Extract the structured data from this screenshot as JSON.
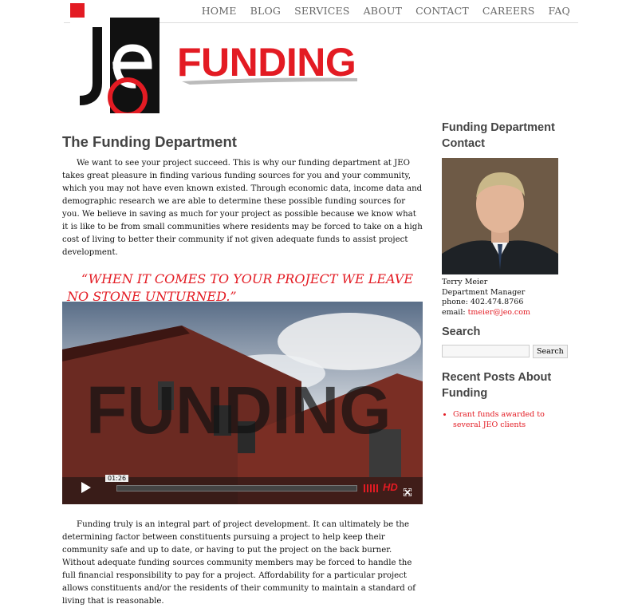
{
  "nav": {
    "items": [
      "HOME",
      "BLOG",
      "SERVICES",
      "ABOUT",
      "CONTACT",
      "CAREERS",
      "FAQ"
    ]
  },
  "logo": {
    "text": "JEO"
  },
  "banner": {
    "title": "FUNDING"
  },
  "main": {
    "heading": "The Funding Department",
    "intro": "We want to see your project succeed. This is why our funding department at JEO takes great pleasure in finding various funding sources for you and your community, which you may not have even known existed. Through economic data, income data and demographic research we are able to determine these possible funding sources for you. We believe in saving as much for your project as possible because we know what it is like to be from small communities where residents may be forced to take on a high cost of living to better their community if not given adequate funds to assist project development.",
    "quote": "“WHEN IT COMES TO YOUR PROJECT WE LEAVE NO STONE UNTURNED.”",
    "video": {
      "overlay_text": "FUNDING",
      "time": "01:26",
      "hd_label": "HD",
      "progress": 0.0
    },
    "body": "Funding truly is an integral part of project development. It can ultimately be the determining factor between constituents pursuing a project to help keep their community safe and up to date, or having to put the project on the back burner. Without adequate funding sources community members may be forced to handle the full financial responsibility to pay for a project. Affordability for a particular project allows constituents and/or the residents of their community to maintain a standard of living that is reasonable."
  },
  "sidebar": {
    "contact_heading": "Funding Department Contact",
    "name": "Terry Meier",
    "title": "Department Manager",
    "phone": "phone: 402.474.8766",
    "email_label": "email: ",
    "email": "tmeier@jeo.com",
    "search_heading": "Search",
    "search_button": "Search",
    "search_placeholder": "",
    "recent_heading": "Recent Posts About Funding",
    "posts": [
      "Grant funds awarded to several JEO clients"
    ]
  },
  "colors": {
    "accent": "#e31b23",
    "heading": "#444444",
    "nav": "#666666"
  }
}
